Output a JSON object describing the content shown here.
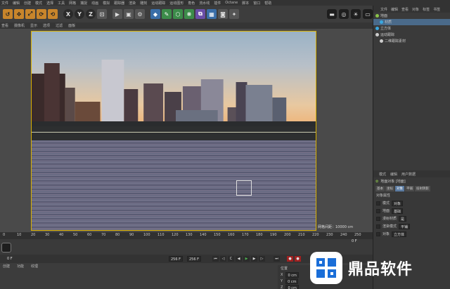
{
  "menubar": {
    "items": [
      "文件",
      "编辑",
      "创建",
      "模式",
      "选择",
      "工具",
      "网格",
      "捕捉",
      "动画",
      "模拟",
      "跟踪器",
      "渲染",
      "雕刻",
      "运动跟踪",
      "运动图形",
      "角色",
      "流水线",
      "插件",
      "Octane",
      "脚本",
      "窗口",
      "帮助"
    ]
  },
  "toolbar": {
    "axis_x": "X",
    "axis_y": "Y",
    "axis_z": "Z"
  },
  "viewport_menu": {
    "items": [
      "查看",
      "摄像机",
      "显示",
      "选项",
      "过滤",
      "面板"
    ]
  },
  "viewport": {
    "grid_info": "网格间距：10000 cm"
  },
  "object_manager": {
    "tabs": [
      "文件",
      "编辑",
      "查看",
      "对象",
      "标签",
      "书签"
    ],
    "rows": [
      {
        "label": "地面",
        "selected": false,
        "color": "#8bc34a"
      },
      {
        "label": "材质",
        "selected": true,
        "color": "#3aa8e0"
      },
      {
        "label": "立方体",
        "selected": false,
        "color": "#3aa8e0"
      },
      {
        "label": "运动跟踪",
        "selected": false,
        "color": "#cccccc"
      },
      {
        "label": "二维跟踪素材",
        "selected": false,
        "color": "#cccccc"
      }
    ]
  },
  "attributes": {
    "tabs": [
      "模式",
      "编辑",
      "用户数据"
    ],
    "title": "地面对象 [地面]",
    "subtabs": [
      "基本",
      "坐标",
      "对象",
      "平铺",
      "投射阴影"
    ],
    "active_subtab": "对象",
    "section": "对象属性",
    "rows": [
      {
        "label": "模式",
        "value": "对象"
      },
      {
        "label": "地面",
        "value": "基础"
      },
      {
        "label": "漫射材质",
        "value": "是"
      },
      {
        "label": "渲染模式",
        "value": "平铺"
      },
      {
        "label": "对象",
        "value": "立方体"
      }
    ]
  },
  "timeline": {
    "ticks": [
      "0",
      "10",
      "20",
      "30",
      "40",
      "50",
      "60",
      "70",
      "80",
      "90",
      "100",
      "110",
      "120",
      "130",
      "140",
      "150",
      "160",
      "170",
      "180",
      "190",
      "200",
      "210",
      "220",
      "230",
      "240",
      "250"
    ],
    "end_frame": "0 F",
    "frame_start": "0 F",
    "frame_end": "256 F",
    "frame_display": "256 F"
  },
  "bottom": {
    "tabs": [
      "创建",
      "功能",
      "纹理"
    ],
    "coord_title": "位置",
    "coords": [
      {
        "axis": "X",
        "value": "0 cm"
      },
      {
        "axis": "Y",
        "value": "0 cm"
      },
      {
        "axis": "Z",
        "value": "0 cm"
      }
    ]
  },
  "watermark": {
    "text": "鼎品软件"
  }
}
